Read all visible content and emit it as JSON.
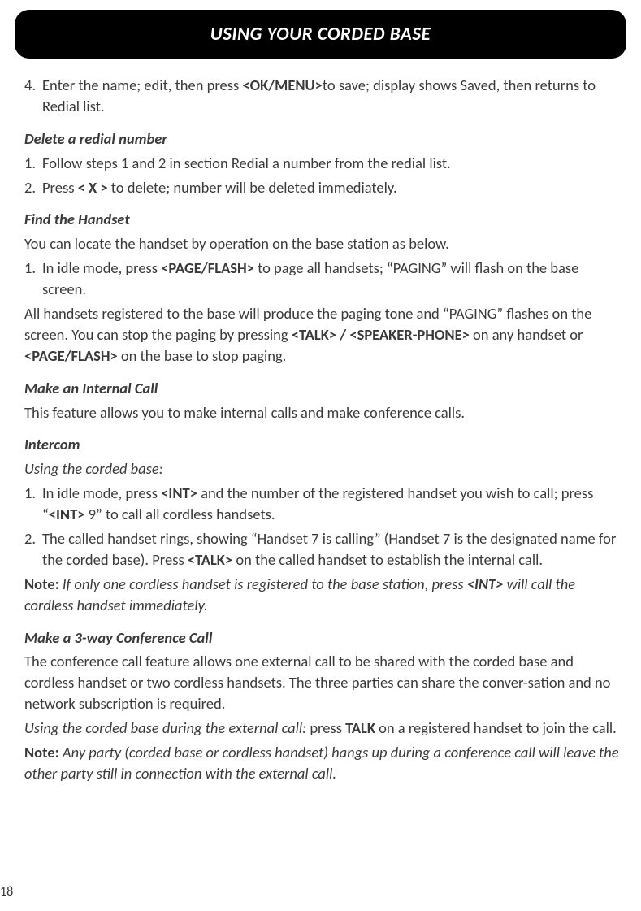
{
  "header": {
    "title": "USING YOUR CORDED BASE"
  },
  "step4": {
    "num": "4.",
    "pre": "Enter the name; edit, then press ",
    "bold": "<OK/MENU>",
    "post": "to save; display shows Saved, then returns to Redial list."
  },
  "delete_redial": {
    "heading": "Delete a redial number",
    "step1": {
      "num": "1.",
      "text": "Follow steps 1 and 2 in section Redial a number from the redial list."
    },
    "step2": {
      "num": "2.",
      "pre": "Press ",
      "bold": "< X >",
      "post": " to delete; number will be deleted immediately."
    }
  },
  "find_handset": {
    "heading": "Find the Handset",
    "intro": "You can locate the handset by operation on the base station as below.",
    "step1": {
      "num": "1.",
      "pre": "In idle mode, press ",
      "bold": "<PAGE/FLASH>",
      "post": " to page all handsets; “PAGING” will flash on the base screen."
    },
    "para_pre": "All handsets registered to the base will produce the paging tone and “PAGING” flashes on the screen. You can stop the paging by pressing ",
    "para_bold1": "<TALK> / <SPEAKER-PHONE>",
    "para_mid": " on any handset or ",
    "para_bold2": "<PAGE/FLASH>",
    "para_post": " on the base to stop paging."
  },
  "internal_call": {
    "heading": "Make an Internal Call",
    "intro": "This feature allows you to make internal calls and make conference calls.",
    "intercom_heading": "Intercom",
    "using_label": "Using the corded base:",
    "step1": {
      "num": "1.",
      "pre": "In idle mode, press ",
      "bold1": "<INT>",
      "mid1": " and the number of the registered handset you wish to call; press “",
      "bold2": "<INT>",
      "post": " 9” to call all cordless handsets."
    },
    "step2": {
      "num": "2.",
      "pre": "The called handset rings, showing “Handset 7 is calling” (Handset 7 is the designated name for the corded base). Press ",
      "bold": "<TALK>",
      "post": " on the called handset to establish the internal call."
    },
    "note_label": "Note:",
    "note_pre": " If only one cordless handset is registered to the base station, press ",
    "note_bold": "<INT>",
    "note_post": " will call the cordless handset immediately."
  },
  "conference": {
    "heading": "Make a 3-way Conference Call",
    "intro": "The conference call feature allows one external call to be shared with the corded base and cordless handset or two cordless handsets. The three parties can share the conver-sation and no network subscription is required.",
    "using_italic": "Using the corded base during the external call:",
    "using_mid": " press ",
    "using_bold": "TALK",
    "using_post": " on a registered handset to join the call.",
    "note_label": "Note:",
    "note_text": " Any party (corded base or cordless handset) hangs up during a conference call will leave the other party still in connection with the external call."
  },
  "page_number": "18"
}
